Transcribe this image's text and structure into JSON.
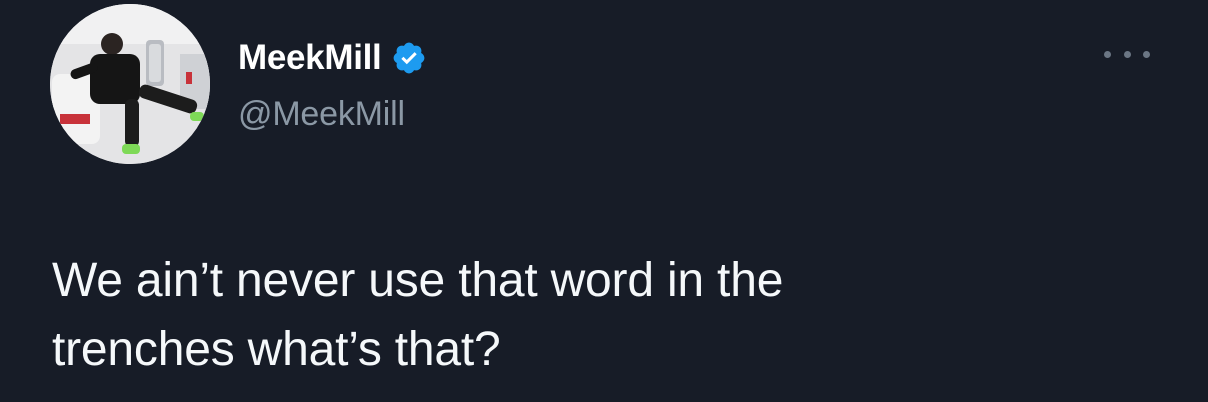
{
  "tweet": {
    "author": {
      "display_name": "MeekMill",
      "handle": "@MeekMill",
      "verified": true,
      "avatar_icon": "profile-photo"
    },
    "text_lines": [
      "We ain’t never use that word in the",
      "trenches what’s that?"
    ],
    "more_icon": "ellipsis-icon"
  },
  "colors": {
    "background": "#171c27",
    "text": "#f5f8fa",
    "secondary_text": "#8b98a5",
    "verified_badge": "#1d9bf0"
  }
}
